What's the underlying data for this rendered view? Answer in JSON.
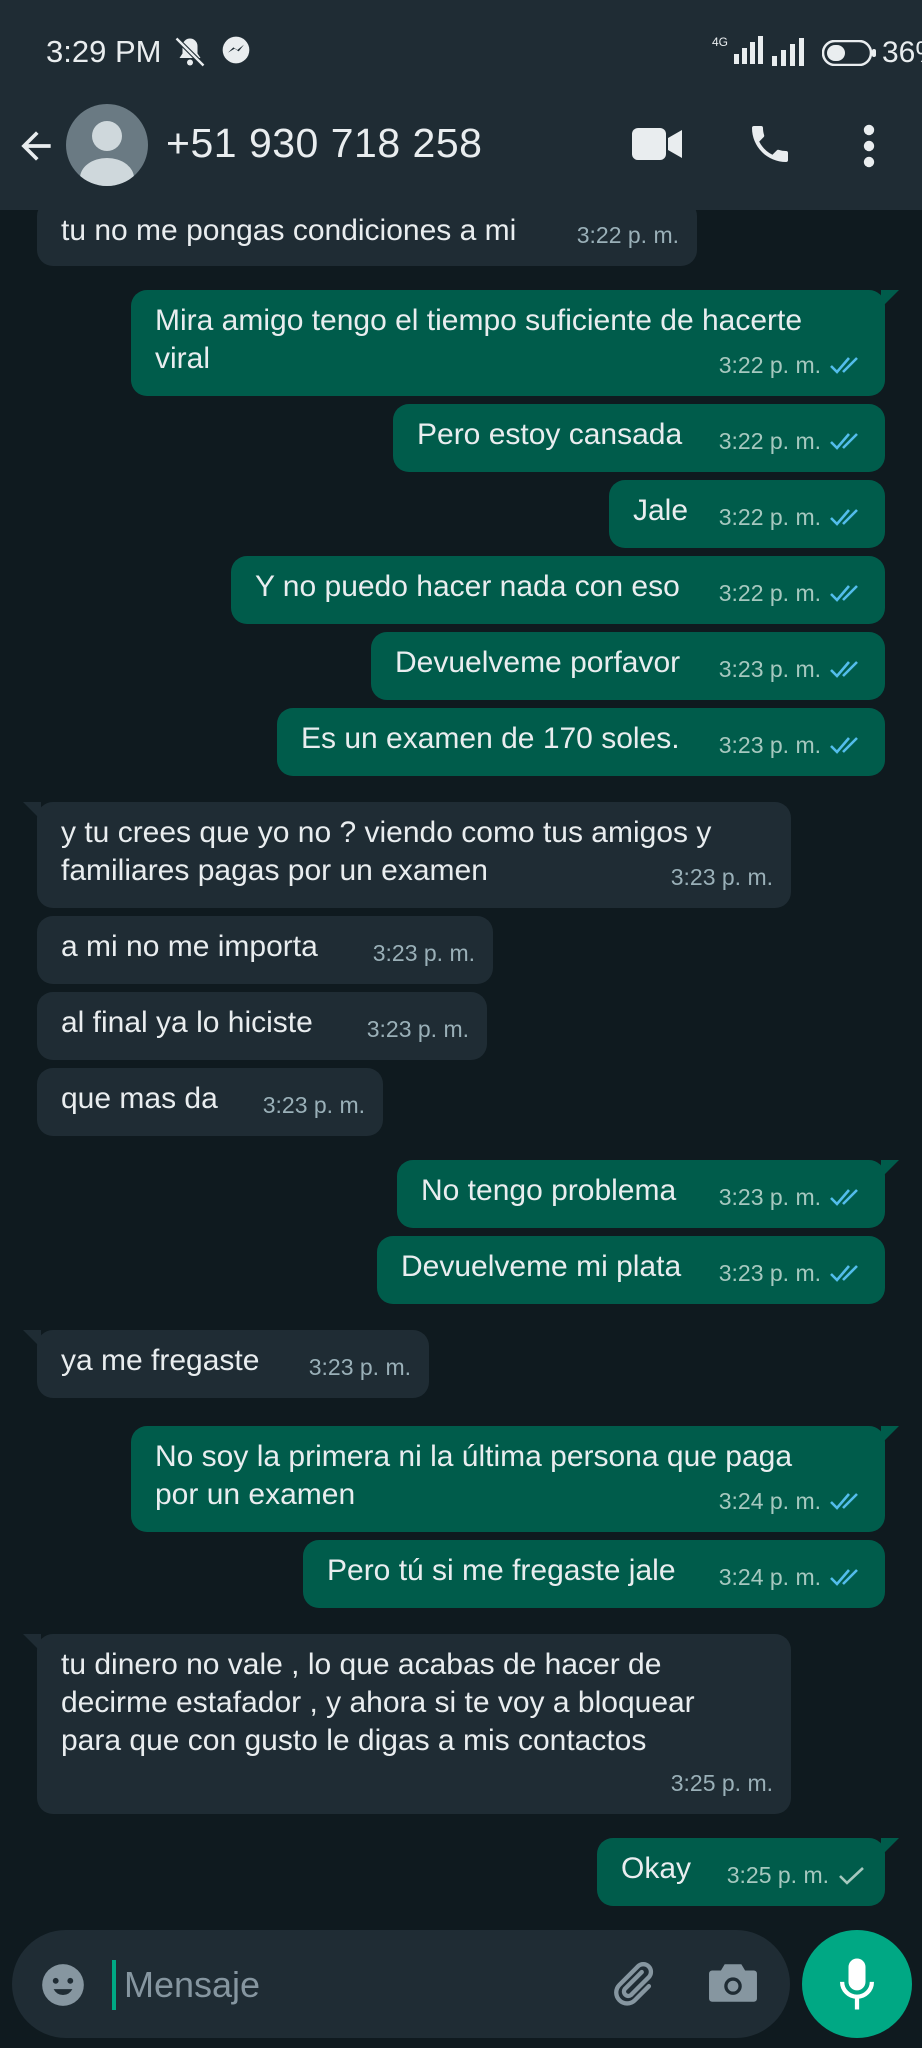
{
  "status_bar": {
    "time": "3:29 PM",
    "network": "4G",
    "battery": "36%"
  },
  "header": {
    "contact": "+51 930 718 258"
  },
  "messages": [
    {
      "dir": "in",
      "text": "tu no me pongas condiciones a mi",
      "time": "3:22 p. m."
    },
    {
      "dir": "out",
      "text": "Mira amigo tengo el tiempo suficiente de hacerte\nviral",
      "time": "3:22 p. m.",
      "status": "read"
    },
    {
      "dir": "out",
      "text": "Pero estoy cansada",
      "time": "3:22 p. m.",
      "status": "read"
    },
    {
      "dir": "out",
      "text": "Jale",
      "time": "3:22 p. m.",
      "status": "read"
    },
    {
      "dir": "out",
      "text": "Y no puedo hacer nada con eso",
      "time": "3:22 p. m.",
      "status": "read"
    },
    {
      "dir": "out",
      "text": "Devuelveme porfavor",
      "time": "3:23 p. m.",
      "status": "read"
    },
    {
      "dir": "out",
      "text": "Es un examen de 170 soles.",
      "time": "3:23 p. m.",
      "status": "read"
    },
    {
      "dir": "in",
      "text": "y tu crees que yo no ? viendo como tus amigos y\nfamiliares pagas por un examen",
      "time": "3:23 p. m."
    },
    {
      "dir": "in",
      "text": "a mi no me importa",
      "time": "3:23 p. m."
    },
    {
      "dir": "in",
      "text": "al final ya lo hiciste",
      "time": "3:23 p. m."
    },
    {
      "dir": "in",
      "text": "que mas da",
      "time": "3:23 p. m."
    },
    {
      "dir": "out",
      "text": "No tengo problema",
      "time": "3:23 p. m.",
      "status": "read"
    },
    {
      "dir": "out",
      "text": "Devuelveme mi plata",
      "time": "3:23 p. m.",
      "status": "read"
    },
    {
      "dir": "in",
      "text": "ya me fregaste",
      "time": "3:23 p. m."
    },
    {
      "dir": "out",
      "text": "No soy la primera ni la última persona que paga\npor un examen",
      "time": "3:24 p. m.",
      "status": "read"
    },
    {
      "dir": "out",
      "text": "Pero tú si me fregaste jale",
      "time": "3:24 p. m.",
      "status": "read"
    },
    {
      "dir": "in",
      "text": "tu dinero no vale , lo que acabas de hacer de\ndecirme estafador , y ahora si te voy a bloquear\npara que con gusto le digas a mis contactos",
      "time": "3:25 p. m."
    },
    {
      "dir": "out",
      "text": "Okay",
      "time": "3:25 p. m.",
      "status": "sent"
    }
  ],
  "composer": {
    "placeholder": "Mensaje"
  },
  "colors": {
    "background": "#0f1a1f",
    "bar": "#1f2c34",
    "incoming": "#1f2c34",
    "outgoing": "#005c4b",
    "accent": "#00a884",
    "read_tick": "#53bdeb"
  },
  "icons": [
    "mute-icon",
    "messenger-icon",
    "signal-icon",
    "battery-icon",
    "back-arrow-icon",
    "video-call-icon",
    "phone-icon",
    "more-vert-icon",
    "emoji-icon",
    "attach-icon",
    "camera-icon",
    "mic-icon",
    "double-check-icon",
    "single-check-icon"
  ]
}
